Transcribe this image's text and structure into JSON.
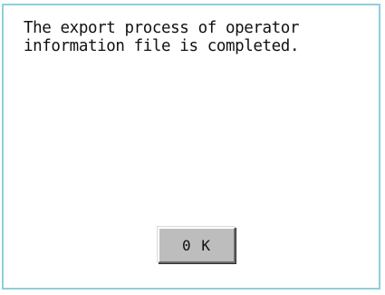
{
  "dialog": {
    "message_line_1": "The export process of operator",
    "message_line_2": "information file is completed.",
    "ok_button_label": "0 K"
  },
  "colors": {
    "dialog_border": "#8fd0d8",
    "button_face": "#bdbdbd",
    "text": "#111111"
  }
}
